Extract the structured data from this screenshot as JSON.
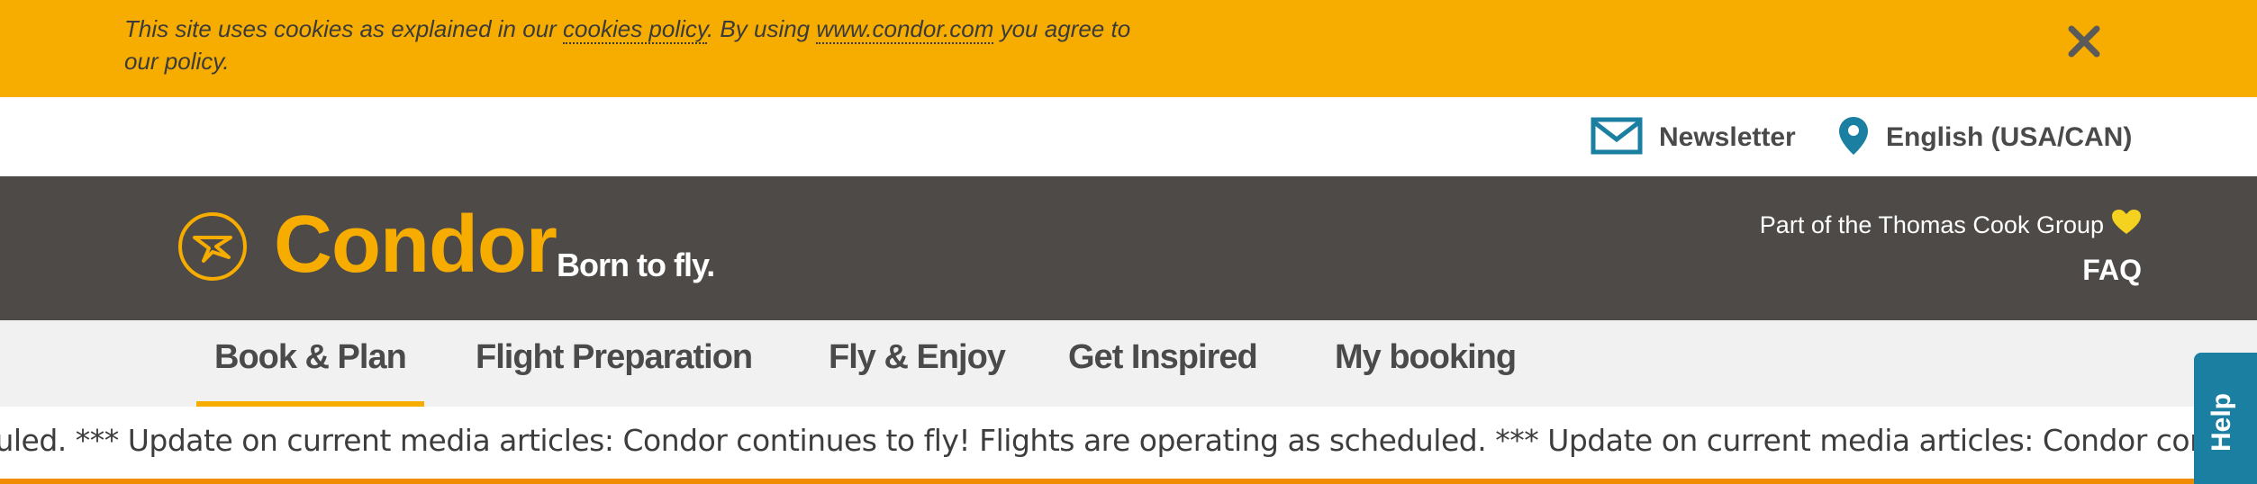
{
  "cookie_banner": {
    "text_before": "This site uses cookies as explained in our ",
    "policy_link": "cookies policy",
    "text_middle": ". By using ",
    "site_link": "www.condor.com",
    "text_after": " you agree to our policy.",
    "close_icon": "close-icon"
  },
  "utility": {
    "newsletter_label": "Newsletter",
    "newsletter_icon": "envelope-icon",
    "language_label": "English (USA/CAN)",
    "language_icon": "location-pin-icon"
  },
  "header": {
    "brand": "Condor",
    "tagline": "Born to fly.",
    "group_text": "Part of the Thomas Cook Group",
    "group_icon": "heart-icon",
    "faq_label": "FAQ"
  },
  "nav": {
    "items": [
      {
        "label": "Book & Plan",
        "active": true
      },
      {
        "label": "Flight Preparation",
        "active": false
      },
      {
        "label": "Fly & Enjoy",
        "active": false
      },
      {
        "label": "Get Inspired",
        "active": false
      },
      {
        "label": "My booking",
        "active": false
      }
    ]
  },
  "ticker": {
    "text": "duled.   ***  Update on current media articles: Condor continues to fly! Flights are operating as scheduled.   ***  Update on current media articles: Condor continues to fly!"
  },
  "help": {
    "label": "Help"
  },
  "colors": {
    "accent": "#f7ad00",
    "header_bg": "#4e4a47",
    "nav_bg": "#f1f1f1",
    "icon_blue": "#1a7fa0",
    "help_bg": "#1a7fa0"
  }
}
